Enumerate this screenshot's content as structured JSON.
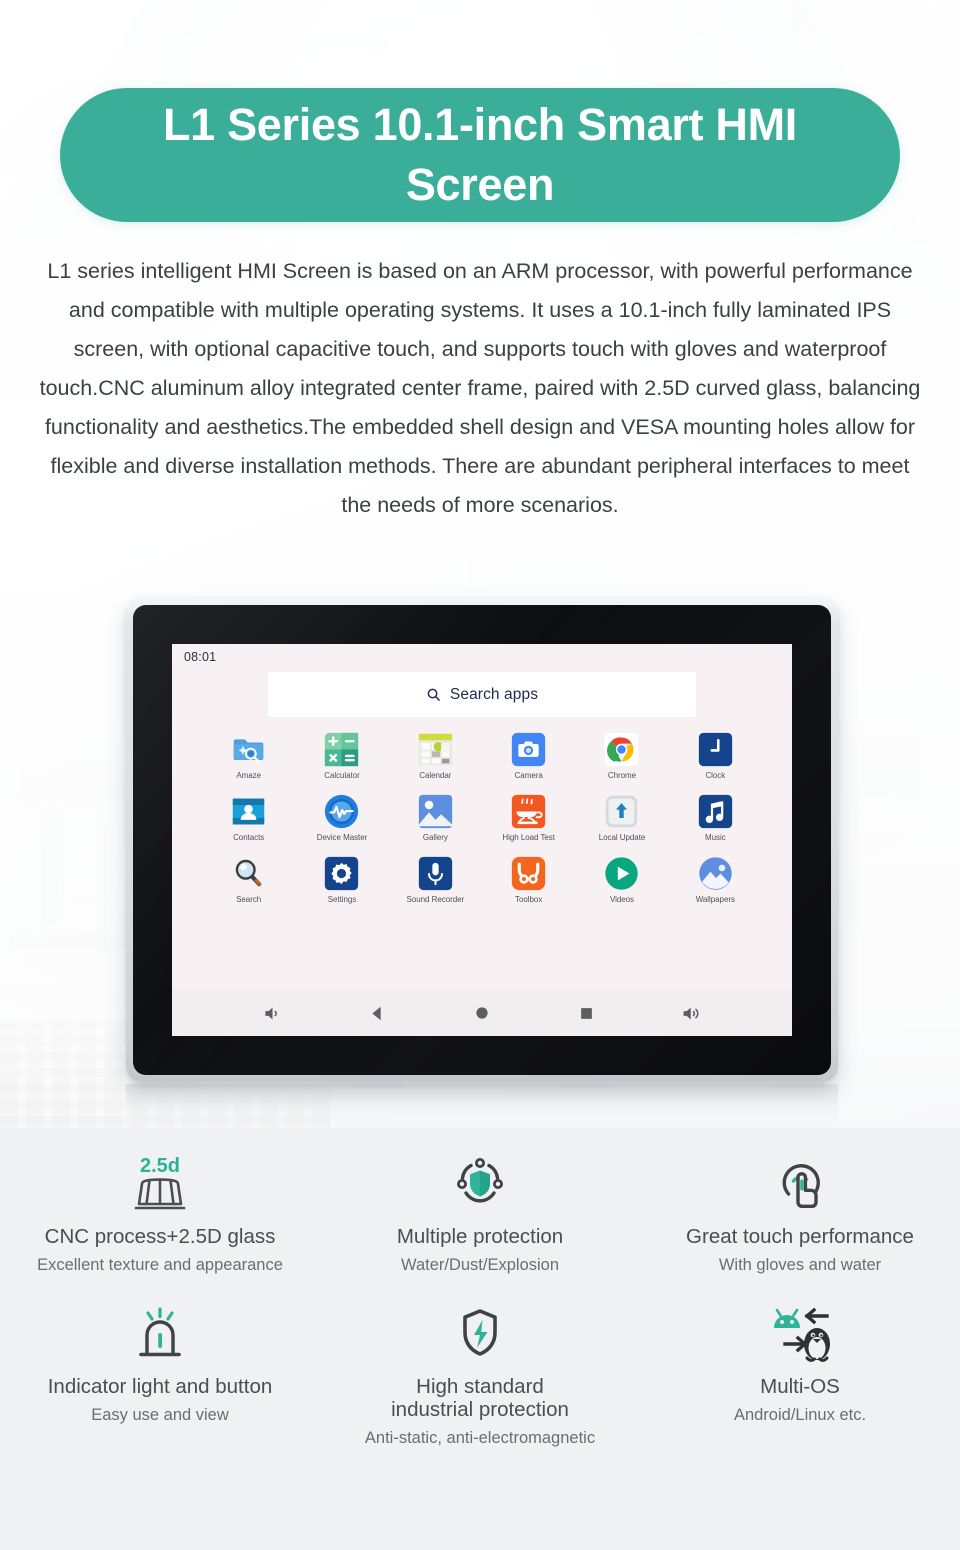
{
  "theme": {
    "accent": "#3aae99",
    "title_text_color": "#ffffff",
    "body_text_color": "#3c4044",
    "panel_bg": "#f0f1f2"
  },
  "header": {
    "title": "L1 Series 10.1-inch Smart HMI Screen"
  },
  "description": "L1 series intelligent HMI Screen is based on an ARM processor, with powerful performance and compatible with multiple operating systems. It uses a 10.1-inch fully laminated IPS screen, with optional capacitive touch, and supports touch with gloves and waterproof touch.CNC aluminum alloy integrated center frame, paired with 2.5D curved glass, balancing functionality and aesthetics.The embedded shell design and VESA mounting holes allow for flexible and diverse installation methods. There are abundant peripheral interfaces to meet the needs of more scenarios.",
  "device": {
    "screen": {
      "status_bar": {
        "clock": "08:01"
      },
      "search": {
        "label": "Search apps",
        "icon": "search-icon"
      },
      "apps": [
        {
          "name": "Amaze",
          "icon": "amaze-icon"
        },
        {
          "name": "Calculator",
          "icon": "calculator-icon"
        },
        {
          "name": "Calendar",
          "icon": "calendar-icon"
        },
        {
          "name": "Camera",
          "icon": "camera-icon"
        },
        {
          "name": "Chrome",
          "icon": "chrome-icon"
        },
        {
          "name": "Clock",
          "icon": "clock-icon"
        },
        {
          "name": "Contacts",
          "icon": "contacts-icon"
        },
        {
          "name": "Device Master",
          "icon": "device-master-icon"
        },
        {
          "name": "Gallery",
          "icon": "gallery-icon"
        },
        {
          "name": "High Load Test",
          "icon": "high-load-test-icon"
        },
        {
          "name": "Local Update",
          "icon": "local-update-icon"
        },
        {
          "name": "Music",
          "icon": "music-icon"
        },
        {
          "name": "Search",
          "icon": "search-app-icon"
        },
        {
          "name": "Settings",
          "icon": "settings-icon"
        },
        {
          "name": "Sound Recorder",
          "icon": "sound-recorder-icon"
        },
        {
          "name": "Toolbox",
          "icon": "toolbox-icon"
        },
        {
          "name": "Videos",
          "icon": "videos-icon"
        },
        {
          "name": "Wallpapers",
          "icon": "wallpapers-icon"
        }
      ],
      "nav_bar": [
        {
          "name": "volume-down-icon"
        },
        {
          "name": "back-icon"
        },
        {
          "name": "home-icon"
        },
        {
          "name": "recents-icon"
        },
        {
          "name": "volume-up-icon"
        }
      ]
    }
  },
  "features": [
    {
      "icon": "glass-panel-2-5d-icon",
      "badge": "2.5d",
      "title": "CNC process+2.5D glass",
      "subtitle": "Excellent texture and appearance"
    },
    {
      "icon": "shield-network-icon",
      "title": "Multiple protection",
      "subtitle": "Water/Dust/Explosion"
    },
    {
      "icon": "touch-hand-icon",
      "title": "Great touch performance",
      "subtitle": "With gloves and water"
    },
    {
      "icon": "indicator-light-icon",
      "title": "Indicator light and button",
      "subtitle": "Easy use and view"
    },
    {
      "icon": "shield-bolt-icon",
      "title_line1": "High standard",
      "title_line2": "industrial protection",
      "title": "High standard industrial protection",
      "subtitle": "Anti-static, anti-electromagnetic"
    },
    {
      "icon": "android-linux-icon",
      "title": "Multi-OS",
      "subtitle": "Android/Linux etc."
    }
  ]
}
